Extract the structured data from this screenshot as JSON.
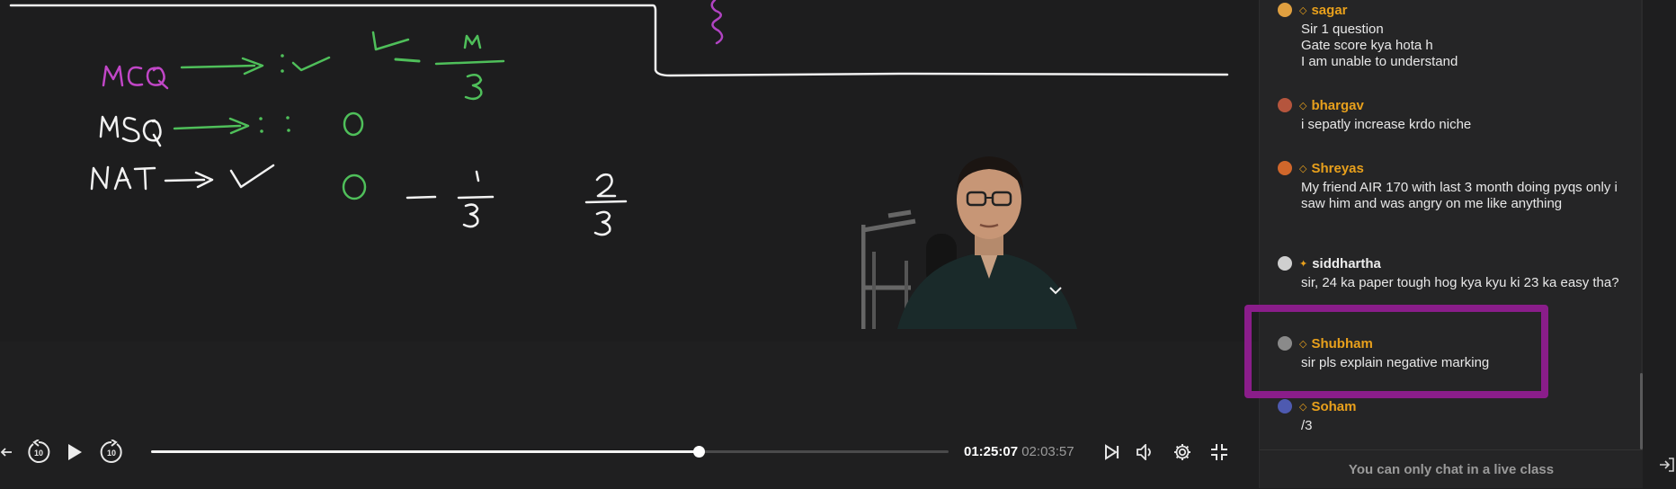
{
  "player": {
    "time_current": "01:25:07",
    "time_total": "02:03:57",
    "progress_fraction": 0.687,
    "skip_back_label": "10",
    "skip_forward_label": "10",
    "icons": [
      "prev-chapter-icon",
      "rewind-10-icon",
      "play-icon",
      "forward-10-icon",
      "next-icon",
      "volume-icon",
      "settings-icon",
      "exit-fullscreen-icon"
    ]
  },
  "chat": {
    "messages": [
      {
        "name": "sagar",
        "badge": "◇",
        "text": "Sir 1 question\nGate score kya hota h\nI am unable to understand",
        "name_color": "#e8a01c"
      },
      {
        "name": "bhargav",
        "badge": "◇",
        "text": "i sepatly increase krdo niche",
        "name_color": "#e8a01c"
      },
      {
        "name": "Shreyas",
        "badge": "◇",
        "text": "My friend AIR 170 with last 3 month doing pyqs only  i saw him and was angry on me like anything",
        "name_color": "#e8a01c"
      },
      {
        "name": "siddhartha",
        "badge": "✦",
        "text": "sir, 24 ka paper tough hog kya kyu ki 23 ka easy tha?",
        "name_color": "#ededed"
      },
      {
        "name": "Shubham",
        "badge": "◇",
        "text": "sir pls explain negative marking",
        "name_color": "#e8a01c"
      },
      {
        "name": "Soham",
        "badge": "◇",
        "text": "/3",
        "name_color": "#e8a01c"
      }
    ],
    "footer": "You can only chat in a live class",
    "highlight_color": "#8a1d8a"
  },
  "board": {
    "labels": [
      "MCQ",
      "MSQ",
      "NAT"
    ],
    "fractions": [
      "m/3",
      "1/3",
      "2/3"
    ],
    "zeros": [
      "0",
      "0"
    ]
  }
}
